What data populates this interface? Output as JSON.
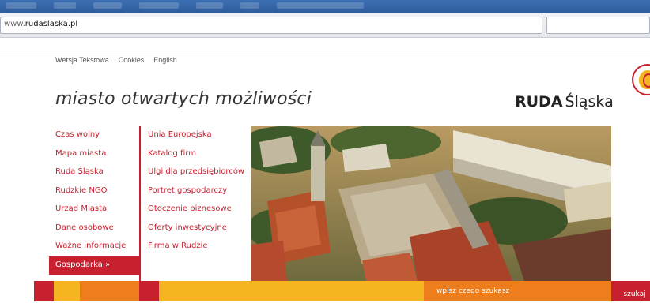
{
  "browser": {
    "address_prefix": "www.",
    "address_host": "rudaslaska.pl"
  },
  "toplinks": [
    "Wersja Tekstowa",
    "Cookies",
    "English"
  ],
  "slogan": "miasto otwartych możliwości",
  "logo": {
    "part1": "RUDA",
    "part2": "Śląska"
  },
  "menu_main": [
    "Czas wolny",
    "Mapa miasta",
    "Ruda Śląska",
    "Rudzkie NGO",
    "Urząd Miasta",
    "Dane osobowe",
    "Ważne informacje",
    "Gospodarka »"
  ],
  "menu_active_index": 7,
  "menu_sub": [
    "Unia Europejska",
    "Katalog firm",
    "Ulgi dla przedsiębiorców",
    "Portret gospodarczy",
    "Otoczenie biznesowe",
    "Oferty inwestycyjne",
    "Firma w Rudzie"
  ],
  "search": {
    "placeholder": "wpisz czego szukasz",
    "button": "szukaj"
  },
  "colors": {
    "brand_red": "#c8202f",
    "brand_yellow": "#f5b521",
    "brand_orange": "#ee7d1b"
  }
}
